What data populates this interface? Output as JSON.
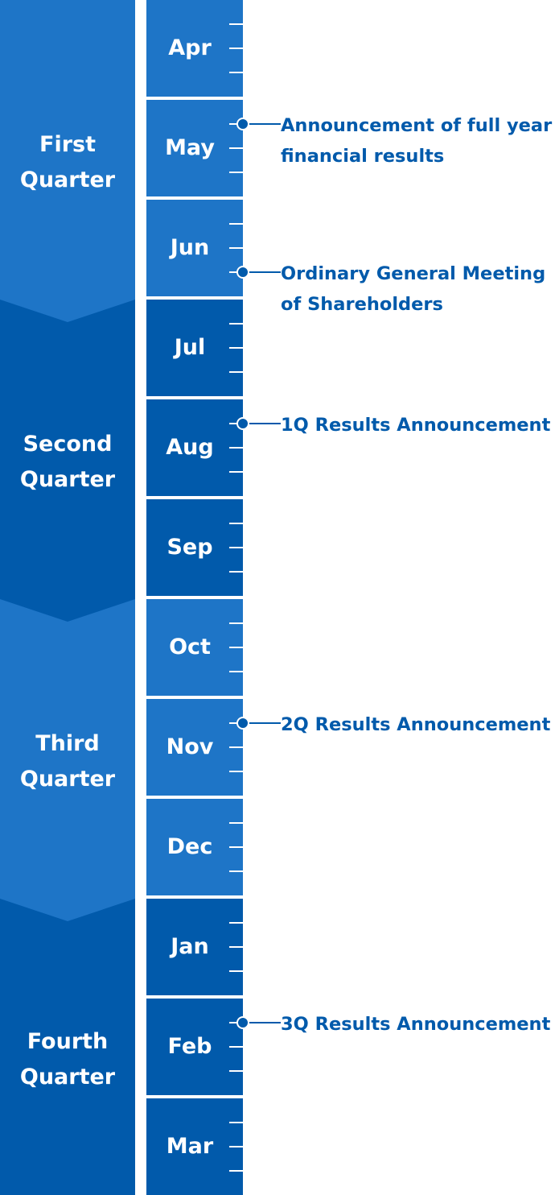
{
  "colors": {
    "light_blue": "#1e75c7",
    "dark_blue": "#015aab",
    "text_blue": "#015aab",
    "white": "#ffffff"
  },
  "quarters": [
    {
      "label_line1": "First",
      "label_line2": "Quarter",
      "shade": "light"
    },
    {
      "label_line1": "Second",
      "label_line2": "Quarter",
      "shade": "dark"
    },
    {
      "label_line1": "Third",
      "label_line2": "Quarter",
      "shade": "light"
    },
    {
      "label_line1": "Fourth",
      "label_line2": "Quarter",
      "shade": "dark"
    }
  ],
  "months": [
    {
      "label": "Apr",
      "quarter": 0
    },
    {
      "label": "May",
      "quarter": 0
    },
    {
      "label": "Jun",
      "quarter": 0
    },
    {
      "label": "Jul",
      "quarter": 1
    },
    {
      "label": "Aug",
      "quarter": 1
    },
    {
      "label": "Sep",
      "quarter": 1
    },
    {
      "label": "Oct",
      "quarter": 2
    },
    {
      "label": "Nov",
      "quarter": 2
    },
    {
      "label": "Dec",
      "quarter": 2
    },
    {
      "label": "Jan",
      "quarter": 3
    },
    {
      "label": "Feb",
      "quarter": 3
    },
    {
      "label": "Mar",
      "quarter": 3
    }
  ],
  "events": [
    {
      "month": "May",
      "tick": 1,
      "line1": "Announcement of full year",
      "line2": "financial results"
    },
    {
      "month": "Jun",
      "tick": 3,
      "line1": "Ordinary General Meeting",
      "line2": "of Shareholders"
    },
    {
      "month": "Aug",
      "tick": 1,
      "line1": "1Q Results Announcement",
      "line2": ""
    },
    {
      "month": "Nov",
      "tick": 1,
      "line1": "2Q Results Announcement",
      "line2": ""
    },
    {
      "month": "Feb",
      "tick": 1,
      "line1": "3Q Results Announcement",
      "line2": ""
    }
  ]
}
